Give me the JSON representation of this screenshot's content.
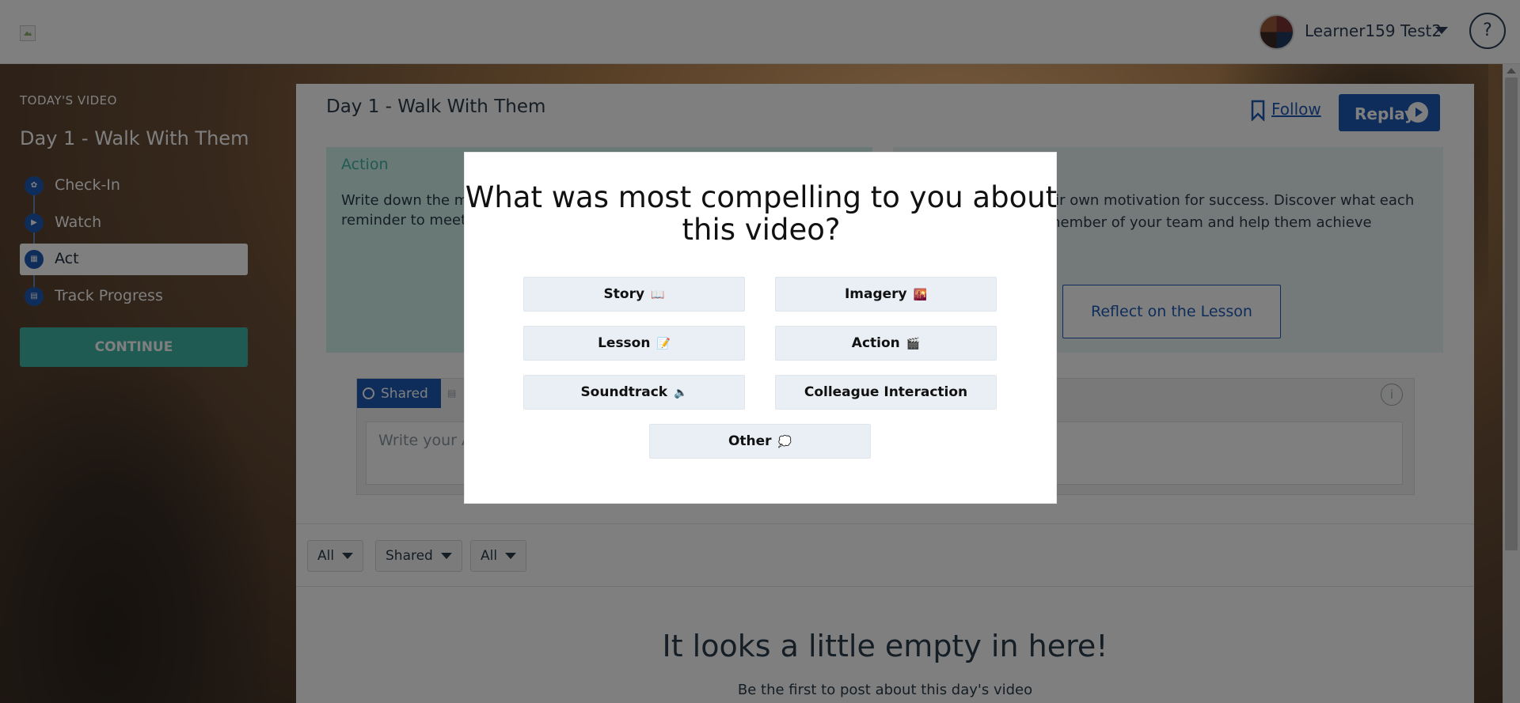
{
  "header": {
    "username": "Learner159 Test2",
    "help_label": "?"
  },
  "sidebar": {
    "section_label": "TODAY'S VIDEO",
    "title": "Day 1 - Walk With Them",
    "steps": [
      {
        "label": "Check-In",
        "icon": "leaf-icon"
      },
      {
        "label": "Watch",
        "icon": "play-icon"
      },
      {
        "label": "Act",
        "icon": "keyboard-icon"
      },
      {
        "label": "Track Progress",
        "icon": "calendar-icon"
      }
    ],
    "continue_label": "CONTINUE"
  },
  "main": {
    "title": "Day 1 - Walk With Them",
    "follow_label": "Follow",
    "replay_label": "Replay",
    "action_label": "Action",
    "action_text_line1": "Write down the m",
    "action_text_line2": "reminder to meet",
    "lesson_text": "eir own motivation for success. Discover what each member of your team and help them achieve",
    "reflect_label": "Reflect on the Lesson",
    "shared_tab_label": "Shared",
    "composer_placeholder": "Write your A",
    "info_label": "i",
    "filters": [
      {
        "label": "All"
      },
      {
        "label": "Shared"
      },
      {
        "label": "All"
      }
    ],
    "empty_heading": "It looks a little empty in here!",
    "empty_sub": "Be the first to post about this day's video"
  },
  "modal": {
    "title": "What was most compelling to you about this video?",
    "options": [
      {
        "label": "Story",
        "emoji": "📖"
      },
      {
        "label": "Imagery",
        "emoji": "🌇"
      },
      {
        "label": "Lesson",
        "emoji": "📝"
      },
      {
        "label": "Action",
        "emoji": "🎬"
      },
      {
        "label": "Soundtrack",
        "emoji": "🔈"
      },
      {
        "label": "Colleague Interaction",
        "emoji": ""
      },
      {
        "label": "Other",
        "emoji": "💭"
      }
    ]
  },
  "colors": {
    "primary": "#1e5bb5",
    "teal": "#3fb6a5",
    "overlay": "rgba(0,0,0,0.5)"
  }
}
